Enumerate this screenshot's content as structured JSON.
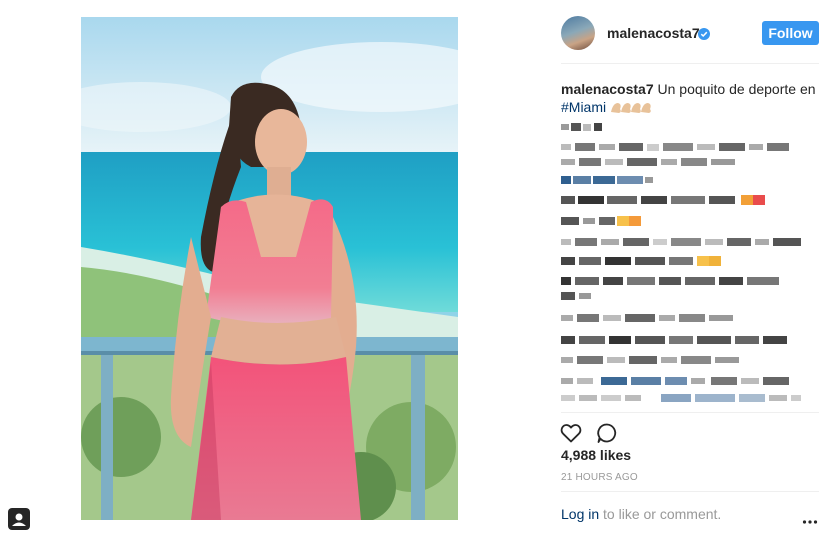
{
  "post": {
    "username": "malenacosta7",
    "follow_label": "Follow",
    "caption_text": "Un poquito de deporte en",
    "hashtag": "#Miami",
    "likes": "4,988 likes",
    "timestamp": "21 HOURS AGO",
    "login_link": "Log in",
    "login_suffix": " to like or comment."
  },
  "icons": {
    "verified": "verified-badge-icon",
    "like": "heart-icon",
    "comment": "comment-icon",
    "more": "more-options-icon",
    "tag": "user-tag-icon"
  },
  "colors": {
    "follow_button": "#3897f0",
    "link": "#003569",
    "secondary_text": "#999999",
    "verified": "#3897f0"
  }
}
